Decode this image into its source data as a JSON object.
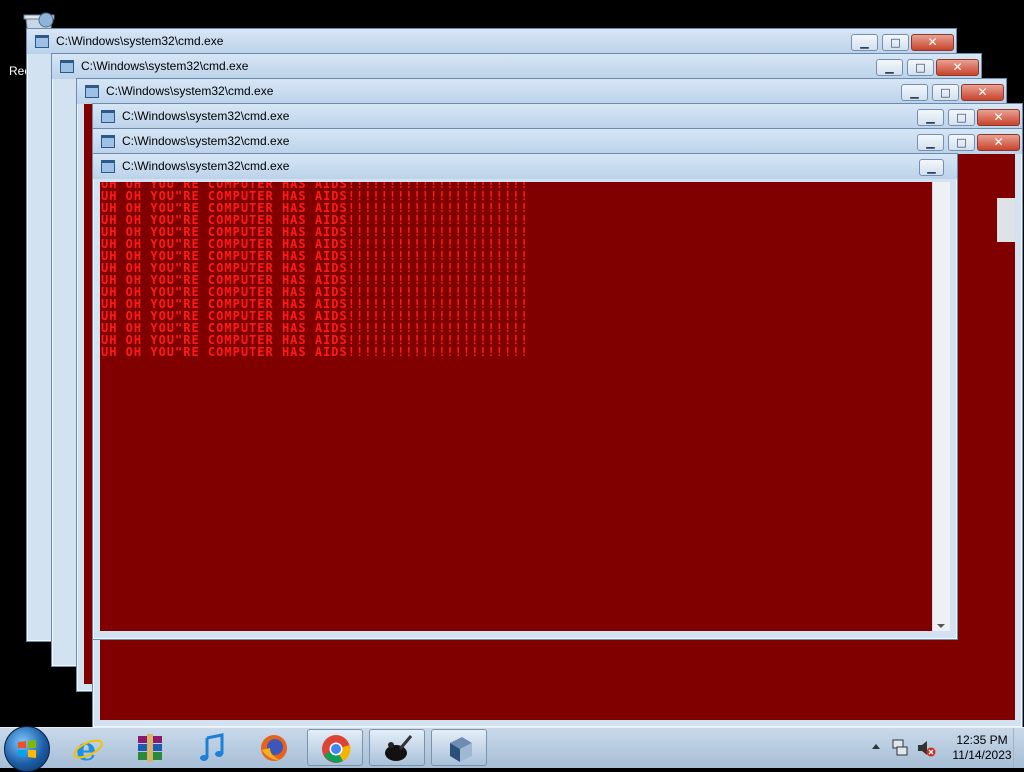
{
  "desktop": {
    "recycle_bin_label": "Recycle"
  },
  "windows": [
    {
      "title": "C:\\Windows\\system32\\cmd.exe"
    },
    {
      "title": "C:\\Windows\\system32\\cmd.exe"
    },
    {
      "title": "C:\\Windows\\system32\\cmd.exe"
    },
    {
      "title": "C:\\Windows\\system32\\cmd.exe"
    },
    {
      "title": "C:\\Windows\\system32\\cmd.exe"
    },
    {
      "title": "C:\\Windows\\system32\\cmd.exe"
    }
  ],
  "window_controls": {
    "minimize": "▁",
    "maximize": "□",
    "close": "✕"
  },
  "console": {
    "text_color": "#ff1a1a",
    "background_color": "#800000",
    "lines": [
      "UH OH YOU\"RE COMPUTER HAS AIDS!!!!!!!!!!!!!!!!!!!!!!",
      "UH OH YOU\"RE COMPUTER HAS AIDS!!!!!!!!!!!!!!!!!!!!!!",
      "UH OH YOU\"RE COMPUTER HAS AIDS!!!!!!!!!!!!!!!!!!!!!!",
      "UH OH YOU\"RE COMPUTER HAS AIDS!!!!!!!!!!!!!!!!!!!!!!",
      "UH OH YOU\"RE COMPUTER HAS AIDS!!!!!!!!!!!!!!!!!!!!!!",
      "UH OH YOU\"RE COMPUTER HAS AIDS!!!!!!!!!!!!!!!!!!!!!!",
      "UH OH YOU\"RE COMPUTER HAS AIDS!!!!!!!!!!!!!!!!!!!!!!",
      "UH OH YOU\"RE COMPUTER HAS AIDS!!!!!!!!!!!!!!!!!!!!!!",
      "UH OH YOU\"RE COMPUTER HAS AIDS!!!!!!!!!!!!!!!!!!!!!!",
      "UH OH YOU\"RE COMPUTER HAS AIDS!!!!!!!!!!!!!!!!!!!!!!",
      "UH OH YOU\"RE COMPUTER HAS AIDS!!!!!!!!!!!!!!!!!!!!!!",
      "UH OH YOU\"RE COMPUTER HAS AIDS!!!!!!!!!!!!!!!!!!!!!!",
      "UH OH YOU\"RE COMPUTER HAS AIDS!!!!!!!!!!!!!!!!!!!!!!",
      "UH OH YOU\"RE COMPUTER HAS AIDS!!!!!!!!!!!!!!!!!!!!!!",
      "UH OH YOU\"RE COMPUTER HAS AIDS!!!!!!!!!!!!!!!!!!!!!!"
    ]
  },
  "taskbar": {
    "pinned": [
      {
        "name": "internet-explorer-icon"
      },
      {
        "name": "winrar-icon"
      },
      {
        "name": "itunes-icon"
      },
      {
        "name": "firefox-icon"
      },
      {
        "name": "chrome-icon",
        "active": true
      },
      {
        "name": "paint-brush-icon",
        "active": true
      },
      {
        "name": "cmd-icon",
        "active": true
      }
    ],
    "clock_time": "12:35 PM",
    "clock_date": "11/14/2023"
  }
}
